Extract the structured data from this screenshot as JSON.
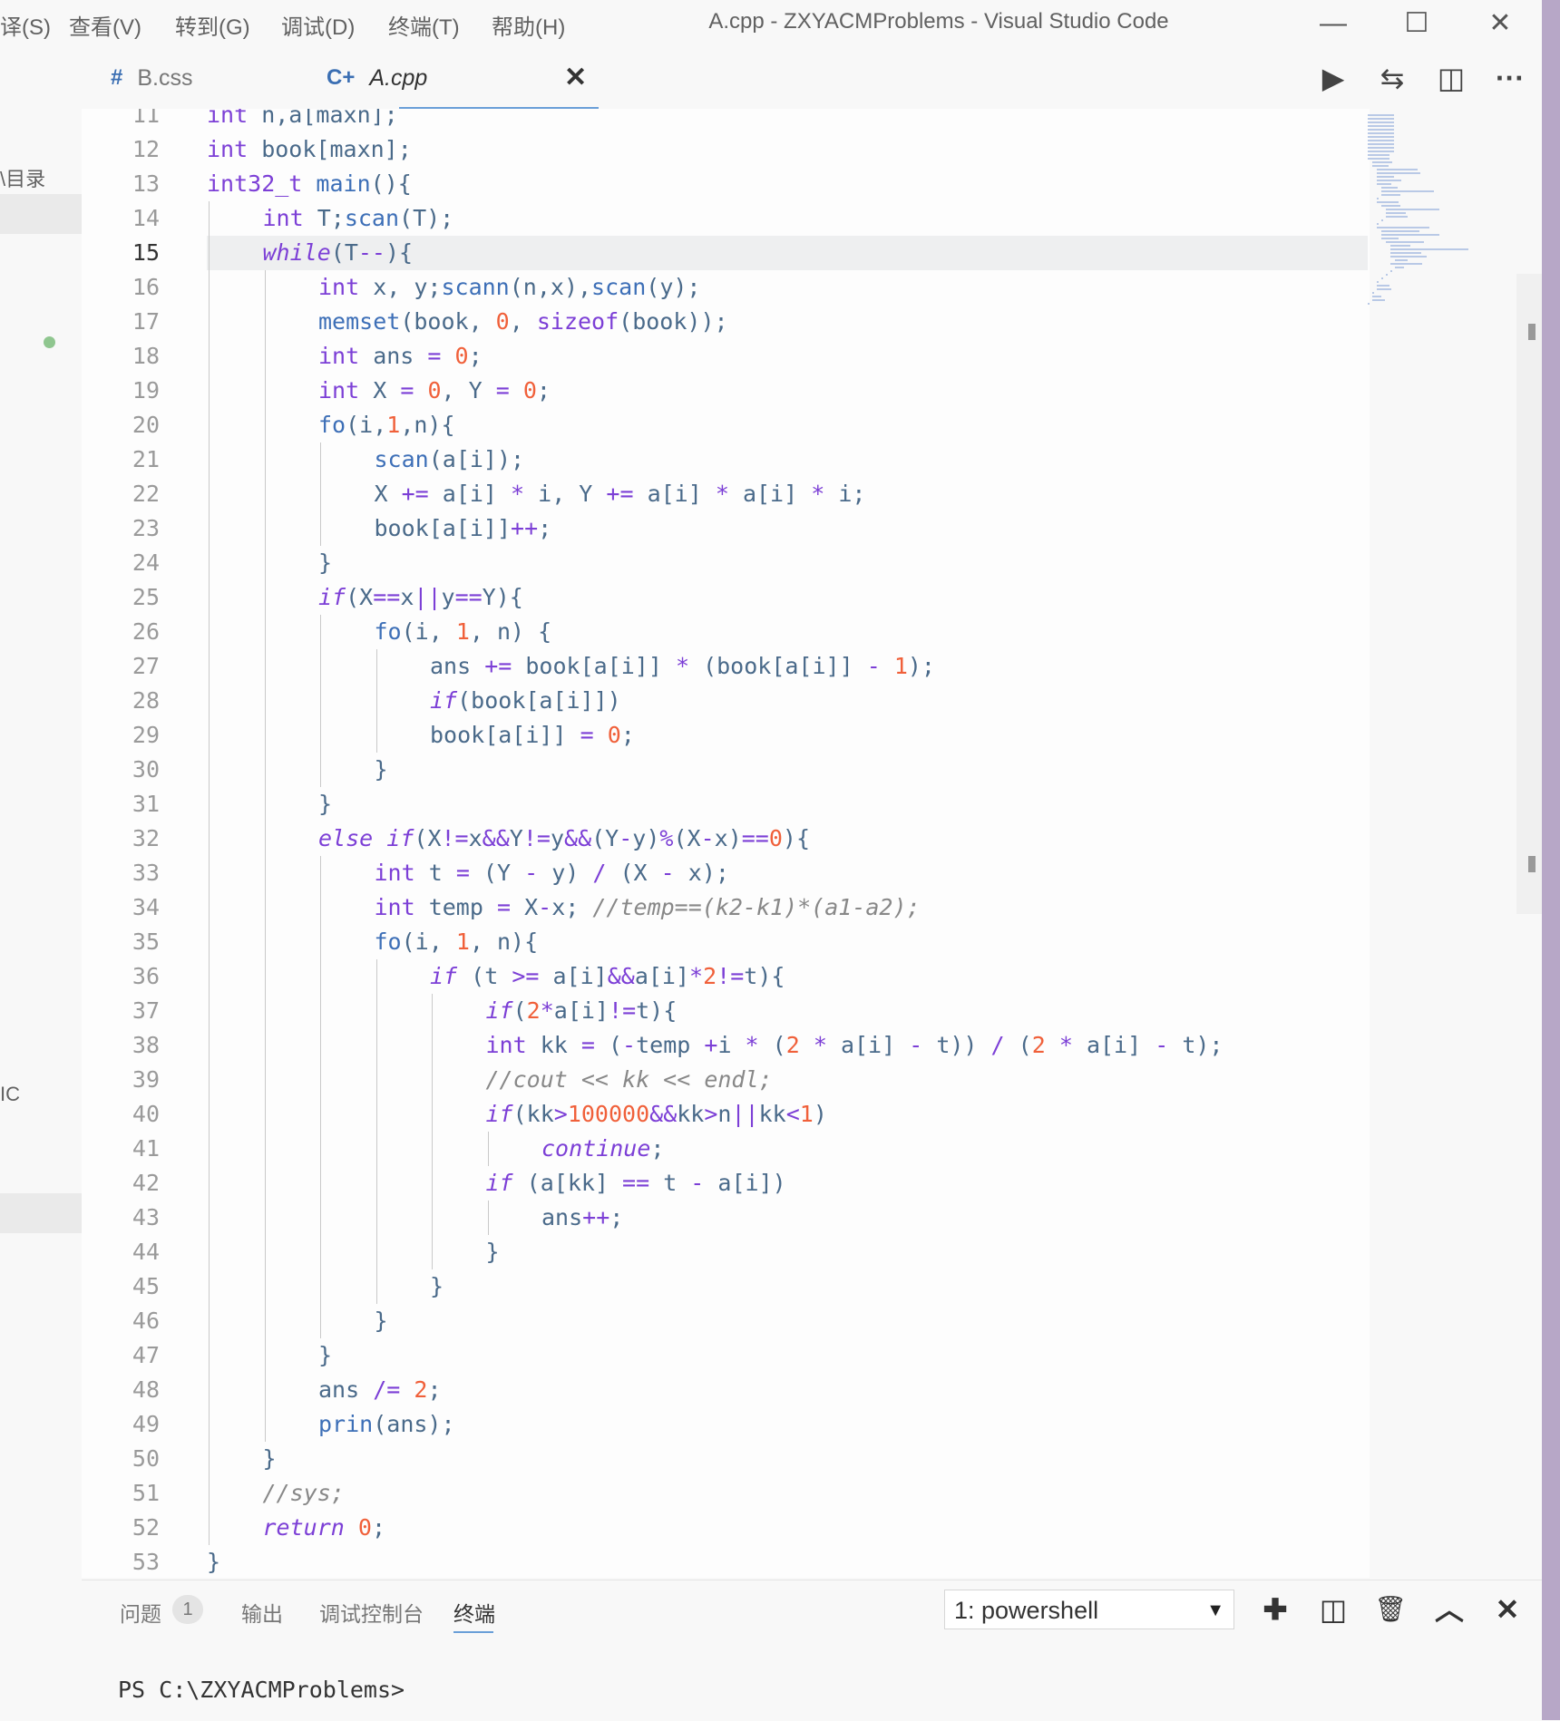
{
  "menu": [
    "译(S)",
    "查看(V)",
    "转到(G)",
    "调试(D)",
    "终端(T)",
    "帮助(H)"
  ],
  "window_title": "A.cpp - ZXYACMProblems - Visual Studio Code",
  "window_controls": {
    "minimize": "—",
    "maximize": "☐",
    "close": "✕"
  },
  "sidebar_fragments": {
    "outline_label": "\\目录",
    "fragment_label": "IC"
  },
  "tabs": [
    {
      "icon": "#",
      "label": "B.css",
      "active": false
    },
    {
      "icon": "C+",
      "label": "A.cpp",
      "active": true
    }
  ],
  "tab_close_glyph": "✕",
  "toolbar_glyphs": {
    "run": "▶",
    "compare": "⇆",
    "split": "◫",
    "more": "···"
  },
  "editor": {
    "current_line": 15,
    "top_partial_line": {
      "number": "11",
      "text": "int n,a[maxn];"
    },
    "lines": [
      {
        "n": "12",
        "indent": 0,
        "text": "int book[maxn];"
      },
      {
        "n": "13",
        "indent": 0,
        "text": "int32_t main(){"
      },
      {
        "n": "14",
        "indent": 1,
        "text": "int T;scan(T);"
      },
      {
        "n": "15",
        "indent": 1,
        "text": "while(T--){"
      },
      {
        "n": "16",
        "indent": 2,
        "text": "int x, y;scann(n,x),scan(y);"
      },
      {
        "n": "17",
        "indent": 2,
        "text": "memset(book, 0, sizeof(book));"
      },
      {
        "n": "18",
        "indent": 2,
        "text": "int ans = 0;"
      },
      {
        "n": "19",
        "indent": 2,
        "text": "int X = 0, Y = 0;"
      },
      {
        "n": "20",
        "indent": 2,
        "text": "fo(i,1,n){"
      },
      {
        "n": "21",
        "indent": 3,
        "text": "scan(a[i]);"
      },
      {
        "n": "22",
        "indent": 3,
        "text": "X += a[i] * i, Y += a[i] * a[i] * i;"
      },
      {
        "n": "23",
        "indent": 3,
        "text": "book[a[i]]++;"
      },
      {
        "n": "24",
        "indent": 2,
        "text": "}"
      },
      {
        "n": "25",
        "indent": 2,
        "text": "if(X==x||y==Y){"
      },
      {
        "n": "26",
        "indent": 3,
        "text": "fo(i, 1, n) {"
      },
      {
        "n": "27",
        "indent": 4,
        "text": "ans += book[a[i]] * (book[a[i]] - 1);"
      },
      {
        "n": "28",
        "indent": 4,
        "text": "if(book[a[i]])"
      },
      {
        "n": "29",
        "indent": 4,
        "text": "book[a[i]] = 0;"
      },
      {
        "n": "30",
        "indent": 3,
        "text": "}"
      },
      {
        "n": "31",
        "indent": 2,
        "text": "}"
      },
      {
        "n": "32",
        "indent": 2,
        "text": "else if(X!=x&&Y!=y&&(Y-y)%(X-x)==0){"
      },
      {
        "n": "33",
        "indent": 3,
        "text": "int t = (Y - y) / (X - x);"
      },
      {
        "n": "34",
        "indent": 3,
        "text": "int temp = X-x; //temp==(k2-k1)*(a1-a2);"
      },
      {
        "n": "35",
        "indent": 3,
        "text": "fo(i, 1, n){"
      },
      {
        "n": "36",
        "indent": 4,
        "text": "if (t >= a[i]&&a[i]*2!=t){"
      },
      {
        "n": "37",
        "indent": 5,
        "text": "if(2*a[i]!=t){"
      },
      {
        "n": "38",
        "indent": 5,
        "text": "int kk = (-temp +i * (2 * a[i] - t)) / (2 * a[i] - t);"
      },
      {
        "n": "39",
        "indent": 5,
        "text": "//cout << kk << endl;"
      },
      {
        "n": "40",
        "indent": 5,
        "text": "if(kk>100000&&kk>n||kk<1)"
      },
      {
        "n": "41",
        "indent": 6,
        "text": "continue;"
      },
      {
        "n": "42",
        "indent": 5,
        "text": "if (a[kk] == t - a[i])"
      },
      {
        "n": "43",
        "indent": 6,
        "text": "ans++;"
      },
      {
        "n": "44",
        "indent": 5,
        "text": "}"
      },
      {
        "n": "45",
        "indent": 4,
        "text": "}"
      },
      {
        "n": "46",
        "indent": 3,
        "text": "}"
      },
      {
        "n": "47",
        "indent": 2,
        "text": "}"
      },
      {
        "n": "48",
        "indent": 2,
        "text": "ans /= 2;"
      },
      {
        "n": "49",
        "indent": 2,
        "text": "prin(ans);"
      },
      {
        "n": "50",
        "indent": 1,
        "text": "}"
      },
      {
        "n": "51",
        "indent": 1,
        "text": "//sys;"
      },
      {
        "n": "52",
        "indent": 1,
        "text": "return 0;"
      },
      {
        "n": "53",
        "indent": 0,
        "text": "}"
      }
    ]
  },
  "panel": {
    "tabs": [
      {
        "label": "问题",
        "badge": "1"
      },
      {
        "label": "输出"
      },
      {
        "label": "调试控制台"
      },
      {
        "label": "终端",
        "active": true
      }
    ],
    "terminal_select": "1: powershell",
    "select_arrow": "▼",
    "buttons": {
      "new": "✚",
      "split": "◫",
      "kill": "🗑",
      "maximize": "︿",
      "close": "✕"
    },
    "prompt": "PS C:\\ZXYACMProblems>"
  },
  "colors": {
    "keyword": "#7c3fd6",
    "number": "#f0603a",
    "function": "#3d6fb7",
    "text": "#4a6a8a",
    "comment": "#888888",
    "accent": "#6a9fd8"
  }
}
